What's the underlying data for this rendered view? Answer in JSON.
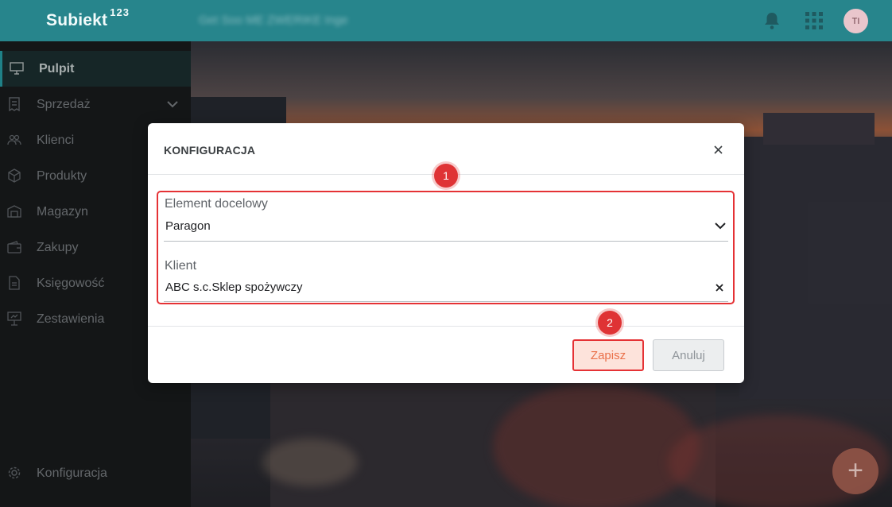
{
  "app": {
    "logo_text": "Subiekt",
    "logo_suffix": "123",
    "company_name": "Get Soo ME ZWERIKE Inge"
  },
  "topbar": {
    "bell_icon": "bell-icon",
    "apps_icon": "grid-icon",
    "avatar_initials": "TI"
  },
  "sidebar": {
    "items": [
      {
        "label": "Pulpit",
        "icon": "monitor-icon",
        "active": true
      },
      {
        "label": "Sprzedaż",
        "icon": "receipt-icon",
        "expandable": true
      },
      {
        "label": "Klienci",
        "icon": "users-icon"
      },
      {
        "label": "Produkty",
        "icon": "box-icon"
      },
      {
        "label": "Magazyn",
        "icon": "warehouse-icon"
      },
      {
        "label": "Zakupy",
        "icon": "wallet-icon"
      },
      {
        "label": "Księgowość",
        "icon": "document-icon"
      },
      {
        "label": "Zestawienia",
        "icon": "presentation-icon"
      }
    ],
    "footer": {
      "label": "Konfiguracja",
      "icon": "gear-icon"
    }
  },
  "modal": {
    "title": "KONFIGURACJA",
    "fields": {
      "target_label": "Element docelowy",
      "target_value": "Paragon",
      "client_label": "Klient",
      "client_value": "ABC s.c.Sklep spożywczy"
    },
    "buttons": {
      "save": "Zapisz",
      "cancel": "Anuluj"
    }
  },
  "annotations": {
    "step1": "1",
    "step2": "2"
  },
  "fab": {
    "label": "+"
  },
  "colors": {
    "topbar": "#27858c",
    "sidebar": "#1d1f21",
    "accent": "#2bb3bb",
    "highlight": "#e53235",
    "save_text": "#ea7049"
  }
}
